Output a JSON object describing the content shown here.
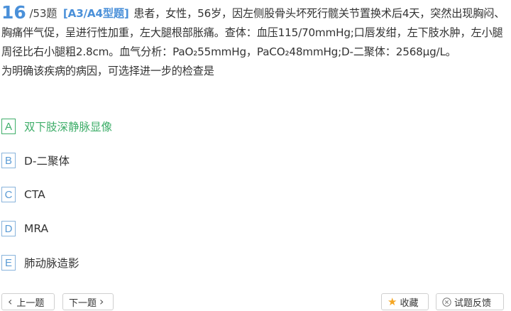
{
  "question": {
    "number": "16",
    "total": "/53题",
    "type": "[A3/A4型题]",
    "stem": "患者，女性，56岁，因左侧股骨头坏死行髋关节置换术后4天，突然出现胸闷、胸痛伴气促，呈进行性加重，左大腿根部胀痛。查体：血压115/70mmHg;口唇发绀，左下肢水肿，左小腿周径比右小腿粗2.8cm。血气分析：PaO₂55mmHg，PaCO₂48mmHg;D-二聚体：2568μg/L。",
    "ask": "为明确该疾病的病因，可选择进一步的检查是"
  },
  "options": [
    {
      "letter": "A",
      "text": "双下肢深静脉显像",
      "state": "correct"
    },
    {
      "letter": "B",
      "text": "D-二聚体",
      "state": "normal"
    },
    {
      "letter": "C",
      "text": "CTA",
      "state": "normal"
    },
    {
      "letter": "D",
      "text": "MRA",
      "state": "normal"
    },
    {
      "letter": "E",
      "text": "肺动脉造影",
      "state": "normal"
    }
  ],
  "footer": {
    "prev_label": "上一题",
    "next_label": "下一题",
    "favorite_label": "收藏",
    "feedback_label": "试题反馈",
    "icons": {
      "prev": "chevron-left-icon",
      "next": "chevron-right-icon",
      "favorite": "star-icon",
      "feedback": "close-circle-icon"
    }
  },
  "colors": {
    "accent": "#4a90d9",
    "correct": "#3fae6a",
    "star": "#f5a623"
  }
}
